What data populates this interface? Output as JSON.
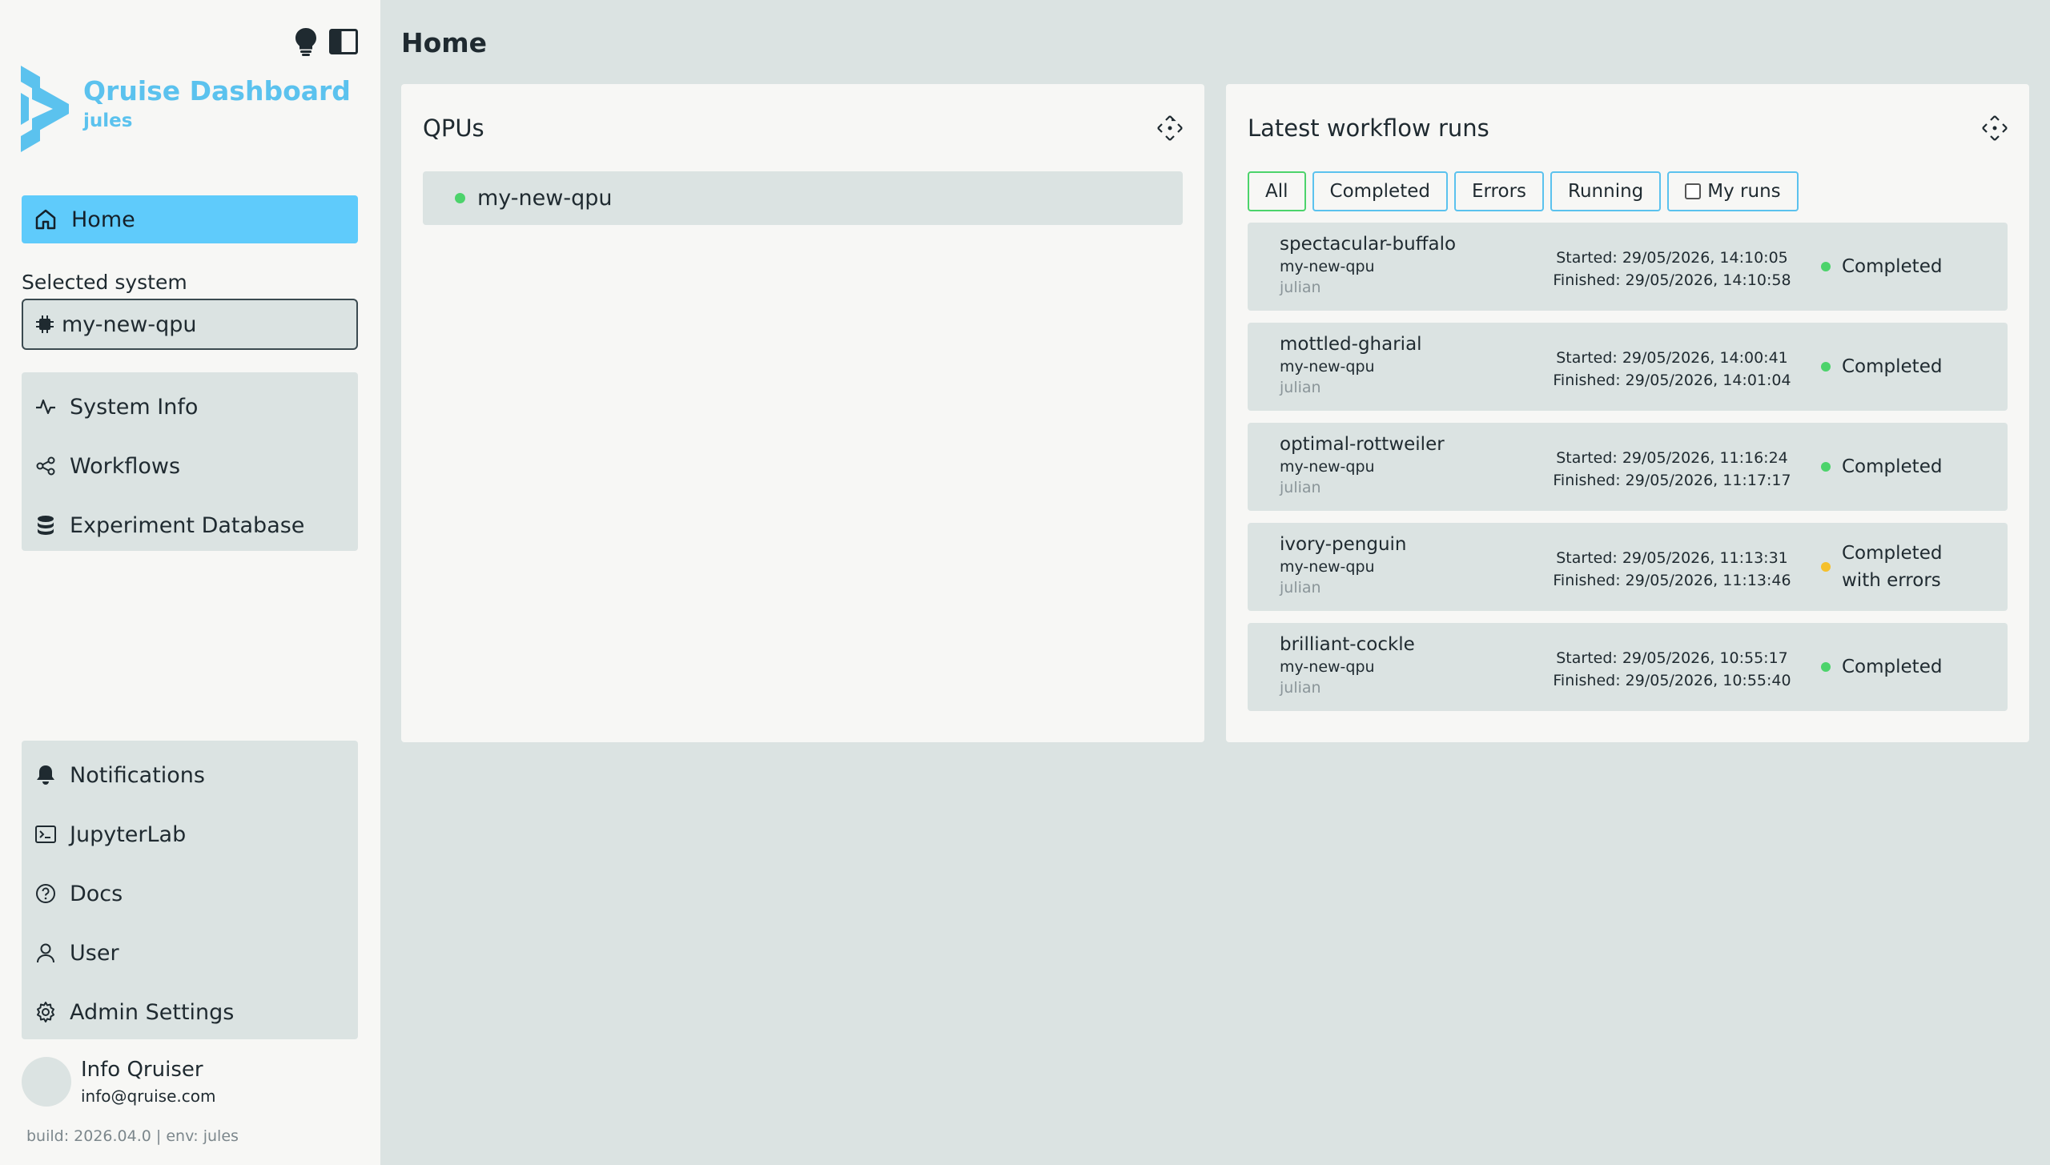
{
  "sidebar": {
    "brand_title": "Qruise Dashboard",
    "brand_sub": "jules",
    "home_label": "Home",
    "selected_system_label": "Selected system",
    "selected_system_value": "my-new-qpu",
    "group1": [
      "System Info",
      "Workflows",
      "Experiment Database"
    ],
    "group2": [
      "Notifications",
      "JupyterLab",
      "Docs",
      "User",
      "Admin Settings"
    ],
    "user_name": "Info Qruiser",
    "user_email": "info@qruise.com",
    "build": "build: 2026.04.0 | env: jules"
  },
  "page": {
    "title": "Home"
  },
  "qpus": {
    "title": "QPUs",
    "items": [
      "my-new-qpu"
    ]
  },
  "runs": {
    "title": "Latest workflow runs",
    "filters": [
      "All",
      "Completed",
      "Errors",
      "Running",
      "My runs"
    ],
    "items": [
      {
        "name": "spectacular-buffalo",
        "qpu": "my-new-qpu",
        "user": "julian",
        "started": "Started: 29/05/2026, 14:10:05",
        "finished": "Finished: 29/05/2026, 14:10:58",
        "status": "Completed"
      },
      {
        "name": "mottled-gharial",
        "qpu": "my-new-qpu",
        "user": "julian",
        "started": "Started: 29/05/2026, 14:00:41",
        "finished": "Finished: 29/05/2026, 14:01:04",
        "status": "Completed"
      },
      {
        "name": "optimal-rottweiler",
        "qpu": "my-new-qpu",
        "user": "julian",
        "started": "Started: 29/05/2026, 11:16:24",
        "finished": "Finished: 29/05/2026, 11:17:17",
        "status": "Completed"
      },
      {
        "name": "ivory-penguin",
        "qpu": "my-new-qpu",
        "user": "julian",
        "started": "Started: 29/05/2026, 11:13:31",
        "finished": "Finished: 29/05/2026, 11:13:46",
        "status": "Completed with errors"
      },
      {
        "name": "brilliant-cockle",
        "qpu": "my-new-qpu",
        "user": "julian",
        "started": "Started: 29/05/2026, 10:55:17",
        "finished": "Finished: 29/05/2026, 10:55:40",
        "status": "Completed"
      }
    ]
  },
  "colors": {
    "accent": "#5fcbfb",
    "brand": "#5bc2ee",
    "success": "#4cd36b",
    "warning": "#f5c02c"
  }
}
